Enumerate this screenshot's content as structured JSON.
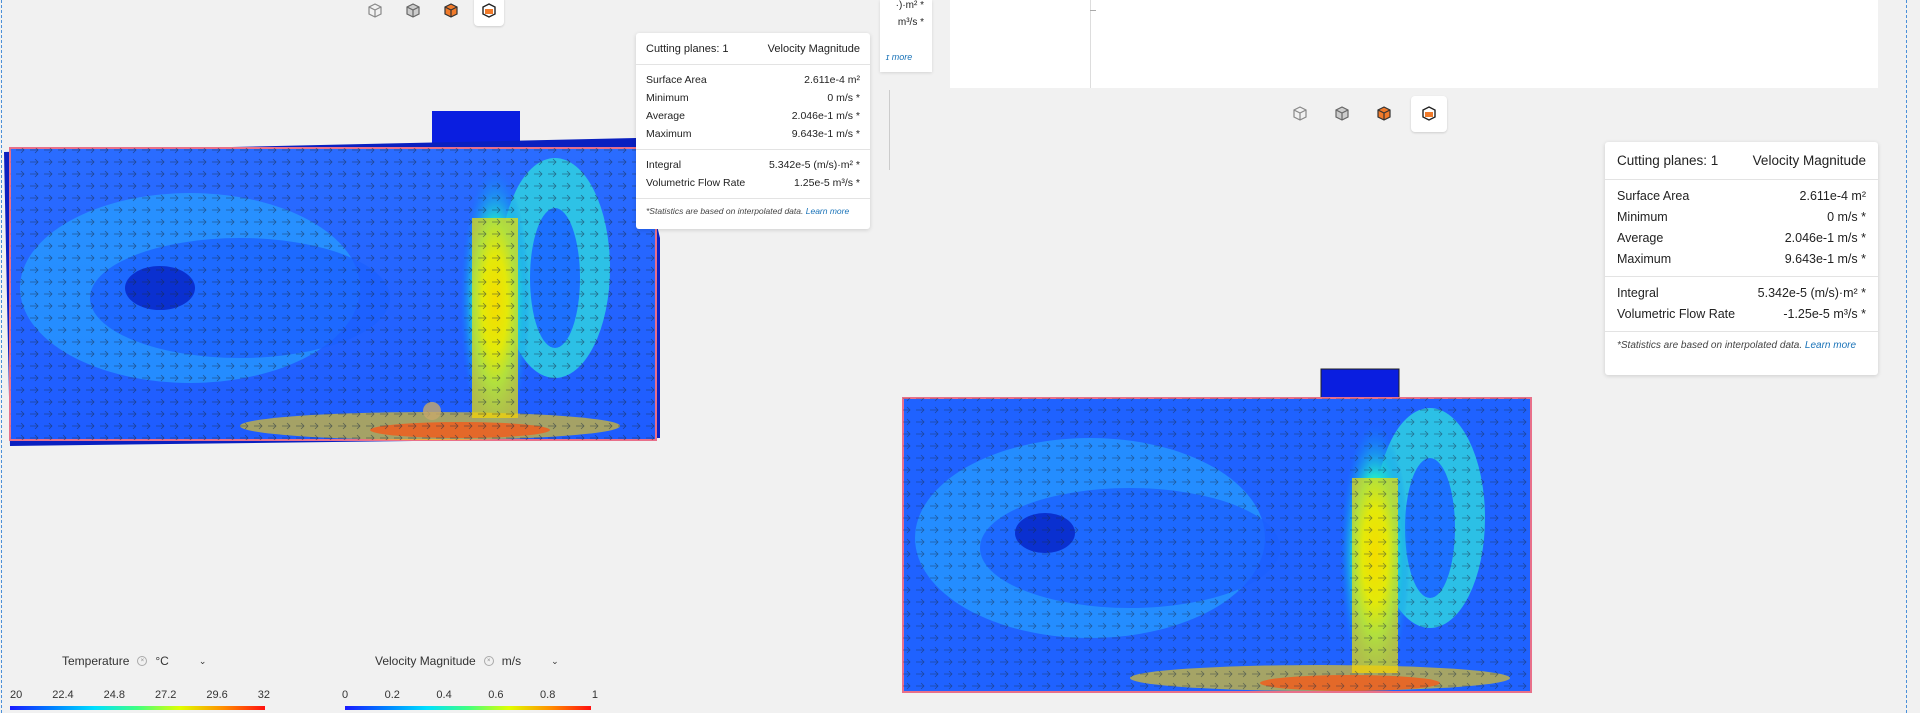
{
  "toolbar_icons": [
    "cube-wireframe-icon",
    "cube-solid-icon",
    "cube-orange-icon",
    "cube-cut-icon"
  ],
  "stats_small": {
    "title": "Cutting planes: 1",
    "field": "Velocity Magnitude",
    "rows": [
      {
        "label": "Surface Area",
        "value": "2.611e-4 m²"
      },
      {
        "label": "Minimum",
        "value": "0 m/s *"
      },
      {
        "label": "Average",
        "value": "2.046e-1 m/s *"
      },
      {
        "label": "Maximum",
        "value": "9.643e-1 m/s *"
      }
    ],
    "rows2": [
      {
        "label": "Integral",
        "value": "5.342e-5 (m/s)·m² *"
      },
      {
        "label": "Volumetric Flow Rate",
        "value": "1.25e-5 m³/s *"
      }
    ],
    "footnote": "*Statistics are based on interpolated data.",
    "learn_more": "Learn more"
  },
  "stats_big": {
    "title": "Cutting planes: 1",
    "field": "Velocity Magnitude",
    "rows": [
      {
        "label": "Surface Area",
        "value": "2.611e-4 m²"
      },
      {
        "label": "Minimum",
        "value": "0 m/s *"
      },
      {
        "label": "Average",
        "value": "2.046e-1 m/s *"
      },
      {
        "label": "Maximum",
        "value": "9.643e-1 m/s *"
      }
    ],
    "rows2": [
      {
        "label": "Integral",
        "value": "5.342e-5 (m/s)·m² *"
      },
      {
        "label": "Volumetric Flow Rate",
        "value": "-1.25e-5 m³/s *"
      }
    ],
    "footnote": "*Statistics are based on interpolated data.",
    "learn_more": "Learn more"
  },
  "partial_panel": {
    "line1": "·)·m² *",
    "line2": "m³/s *",
    "link": "ɪ more"
  },
  "legend_temp": {
    "label": "Temperature",
    "unit": "°C",
    "ticks": [
      "20",
      "22.4",
      "24.8",
      "27.2",
      "29.6",
      "32"
    ]
  },
  "legend_vel": {
    "label": "Velocity Magnitude",
    "unit": "m/s",
    "ticks": [
      "0",
      "0.2",
      "0.4",
      "0.6",
      "0.8",
      "1"
    ]
  },
  "colors": {
    "accent": "#1a73b8",
    "outline": "#e8708a"
  }
}
